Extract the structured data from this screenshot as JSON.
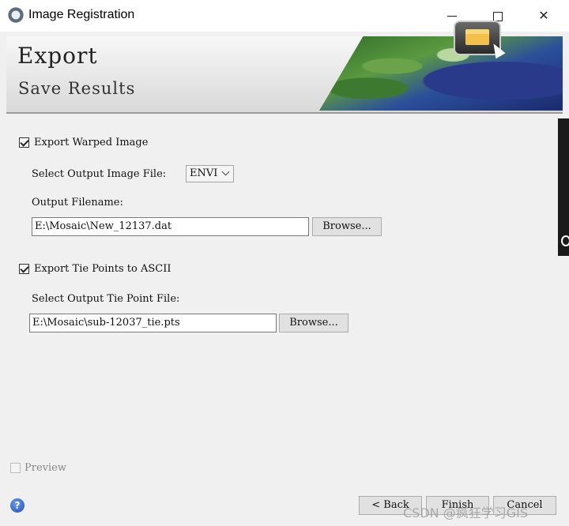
{
  "window": {
    "title": "Image Registration",
    "controls": {
      "minimize": "minimize",
      "maximize": "maximize",
      "close": "✕"
    }
  },
  "banner": {
    "title": "Export",
    "subtitle": "Save Results"
  },
  "warped_image": {
    "checkbox_label": "Export Warped Image",
    "checked": true,
    "file_type_label": "Select Output Image File:",
    "file_type_value": "ENVI",
    "filename_label": "Output Filename:",
    "filename_value": "E:\\Mosaic\\New_12137.dat",
    "browse_label": "Browse..."
  },
  "tie_points": {
    "checkbox_label": "Export Tie Points to ASCII",
    "checked": true,
    "file_label": "Select Output Tie Point File:",
    "file_value": "E:\\Mosaic\\sub-12037_tie.pts",
    "browse_label": "Browse..."
  },
  "preview": {
    "label": "Preview",
    "checked": false,
    "enabled": false
  },
  "footer": {
    "help_glyph": "?",
    "back_label": "< Back",
    "finish_label": "Finish",
    "cancel_label": "Cancel"
  },
  "watermark": "CSDN @疯狂学习GIS",
  "icons": [
    "app-icon",
    "minimize-icon",
    "maximize-icon",
    "close-icon",
    "folder-icon",
    "cursor-icon",
    "chevron-down-icon",
    "help-icon"
  ],
  "colors": {
    "window_bg": "#f0f0f0",
    "titlebar_bg": "#ffffff",
    "help_blue": "#1f4fb5"
  }
}
